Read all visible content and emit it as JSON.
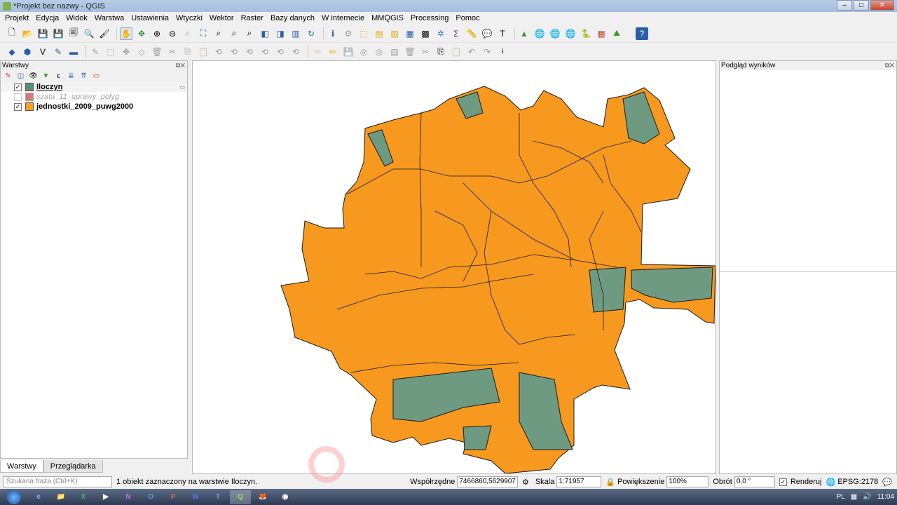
{
  "window": {
    "title": "*Projekt bez nazwy - QGIS",
    "buttons": [
      "–",
      "□",
      "✕"
    ]
  },
  "menu": [
    "Projekt",
    "Edycja",
    "Widok",
    "Warstwa",
    "Ustawienia",
    "Wtyczki",
    "Wektor",
    "Raster",
    "Bazy danych",
    "W internecie",
    "MMQGIS",
    "Processing",
    "Pomoc"
  ],
  "layers_panel": {
    "title": "Warstwy",
    "layers": [
      {
        "name": "Iloczyn",
        "checked": "✓",
        "color": "#5b9077"
      },
      {
        "name": "szata_11_uprawy_polyg",
        "checked": "",
        "color": "#d47a7a"
      },
      {
        "name": "jednostki_2009_puwg2000",
        "checked": "✓",
        "color": "#f7a21a"
      }
    ],
    "tabs": [
      "Warstwy",
      "Przeglądarka"
    ]
  },
  "right_panel": {
    "title": "Podgląd wyników"
  },
  "map": {
    "fill": "#f7991f",
    "overlay_fill": "#6f9a82",
    "stroke": "#1a1a1a"
  },
  "status": {
    "search_placeholder": "Szukana fraza (Ctrl+K)",
    "message": "1 obiekt zaznaczony na warstwie Iloczyn.",
    "coord_label": "Współrzędne",
    "coord_value": "7466860,5629907",
    "scale_label": "Skala",
    "scale_value": "1:71957",
    "zoom_label": "Powiększenie",
    "zoom_value": "100%",
    "rotation_label": "Obrót",
    "rotation_value": "0,0 °",
    "render_label": "Renderuj",
    "crs": "EPSG:2178"
  },
  "taskbar": {
    "items": [
      "e",
      "📁",
      "X",
      "▶",
      "N",
      "O",
      "P",
      "W",
      "T",
      "Q",
      "🦊",
      "◉"
    ],
    "lang": "PL",
    "time": "11:04"
  }
}
